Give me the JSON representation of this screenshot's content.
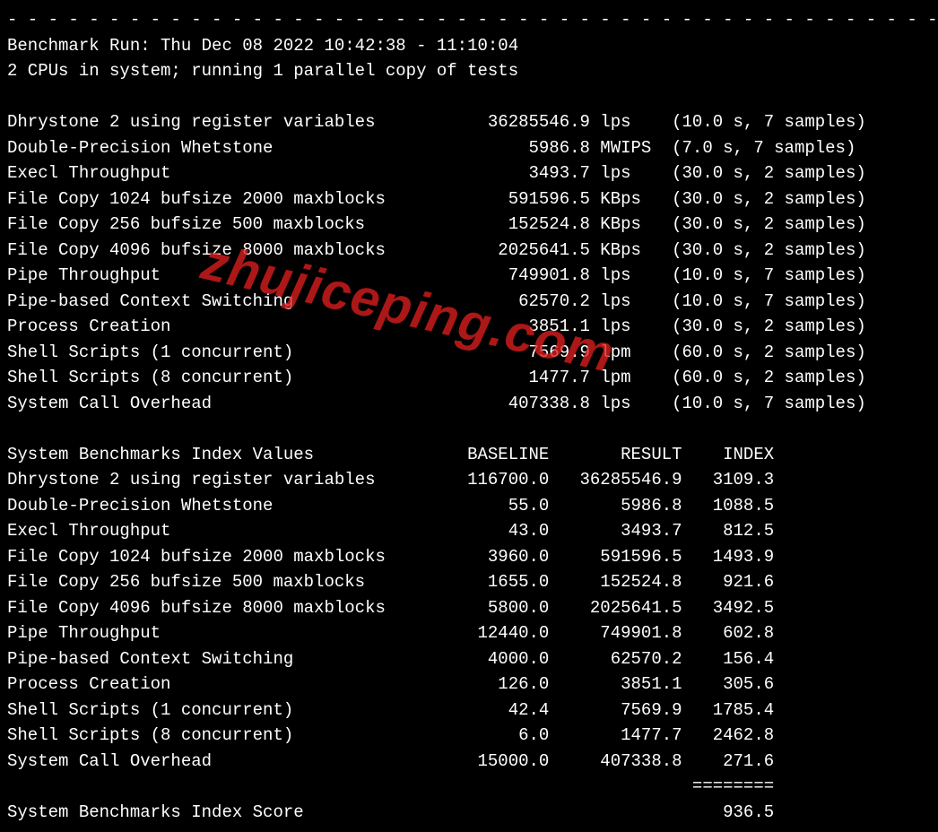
{
  "dashes": "- - - - - - - - - - - - - - - - - - - - - - - - - - - - - - - - - - - - - - - - - - - - - -",
  "run_line": "Benchmark Run: Thu Dec 08 2022 10:42:38 - 11:10:04",
  "cpu_line": "2 CPUs in system; running 1 parallel copy of tests",
  "watermark": "zhujiceping.com",
  "results_header": "System Benchmarks Index Values               BASELINE       RESULT    INDEX",
  "raw_rows": [
    {
      "name": "Dhrystone 2 using register variables",
      "value": "36285546.9",
      "unit": "lps",
      "timing": "(10.0 s, 7 samples)"
    },
    {
      "name": "Double-Precision Whetstone",
      "value": "5986.8",
      "unit": "MWIPS",
      "timing": "(7.0 s, 7 samples)"
    },
    {
      "name": "Execl Throughput",
      "value": "3493.7",
      "unit": "lps",
      "timing": "(30.0 s, 2 samples)"
    },
    {
      "name": "File Copy 1024 bufsize 2000 maxblocks",
      "value": "591596.5",
      "unit": "KBps",
      "timing": "(30.0 s, 2 samples)"
    },
    {
      "name": "File Copy 256 bufsize 500 maxblocks",
      "value": "152524.8",
      "unit": "KBps",
      "timing": "(30.0 s, 2 samples)"
    },
    {
      "name": "File Copy 4096 bufsize 8000 maxblocks",
      "value": "2025641.5",
      "unit": "KBps",
      "timing": "(30.0 s, 2 samples)"
    },
    {
      "name": "Pipe Throughput",
      "value": "749901.8",
      "unit": "lps",
      "timing": "(10.0 s, 7 samples)"
    },
    {
      "name": "Pipe-based Context Switching",
      "value": "62570.2",
      "unit": "lps",
      "timing": "(10.0 s, 7 samples)"
    },
    {
      "name": "Process Creation",
      "value": "3851.1",
      "unit": "lps",
      "timing": "(30.0 s, 2 samples)"
    },
    {
      "name": "Shell Scripts (1 concurrent)",
      "value": "7569.9",
      "unit": "lpm",
      "timing": "(60.0 s, 2 samples)"
    },
    {
      "name": "Shell Scripts (8 concurrent)",
      "value": "1477.7",
      "unit": "lpm",
      "timing": "(60.0 s, 2 samples)"
    },
    {
      "name": "System Call Overhead",
      "value": "407338.8",
      "unit": "lps",
      "timing": "(10.0 s, 7 samples)"
    }
  ],
  "index_rows": [
    {
      "name": "Dhrystone 2 using register variables",
      "baseline": "116700.0",
      "result": "36285546.9",
      "index": "3109.3"
    },
    {
      "name": "Double-Precision Whetstone",
      "baseline": "55.0",
      "result": "5986.8",
      "index": "1088.5"
    },
    {
      "name": "Execl Throughput",
      "baseline": "43.0",
      "result": "3493.7",
      "index": "812.5"
    },
    {
      "name": "File Copy 1024 bufsize 2000 maxblocks",
      "baseline": "3960.0",
      "result": "591596.5",
      "index": "1493.9"
    },
    {
      "name": "File Copy 256 bufsize 500 maxblocks",
      "baseline": "1655.0",
      "result": "152524.8",
      "index": "921.6"
    },
    {
      "name": "File Copy 4096 bufsize 8000 maxblocks",
      "baseline": "5800.0",
      "result": "2025641.5",
      "index": "3492.5"
    },
    {
      "name": "Pipe Throughput",
      "baseline": "12440.0",
      "result": "749901.8",
      "index": "602.8"
    },
    {
      "name": "Pipe-based Context Switching",
      "baseline": "4000.0",
      "result": "62570.2",
      "index": "156.4"
    },
    {
      "name": "Process Creation",
      "baseline": "126.0",
      "result": "3851.1",
      "index": "305.6"
    },
    {
      "name": "Shell Scripts (1 concurrent)",
      "baseline": "42.4",
      "result": "7569.9",
      "index": "1785.4"
    },
    {
      "name": "Shell Scripts (8 concurrent)",
      "baseline": "6.0",
      "result": "1477.7",
      "index": "2462.8"
    },
    {
      "name": "System Call Overhead",
      "baseline": "15000.0",
      "result": "407338.8",
      "index": "271.6"
    }
  ],
  "sep_line": "                                                                   ========",
  "score_label": "System Benchmarks Index Score",
  "score_value": "936.5"
}
